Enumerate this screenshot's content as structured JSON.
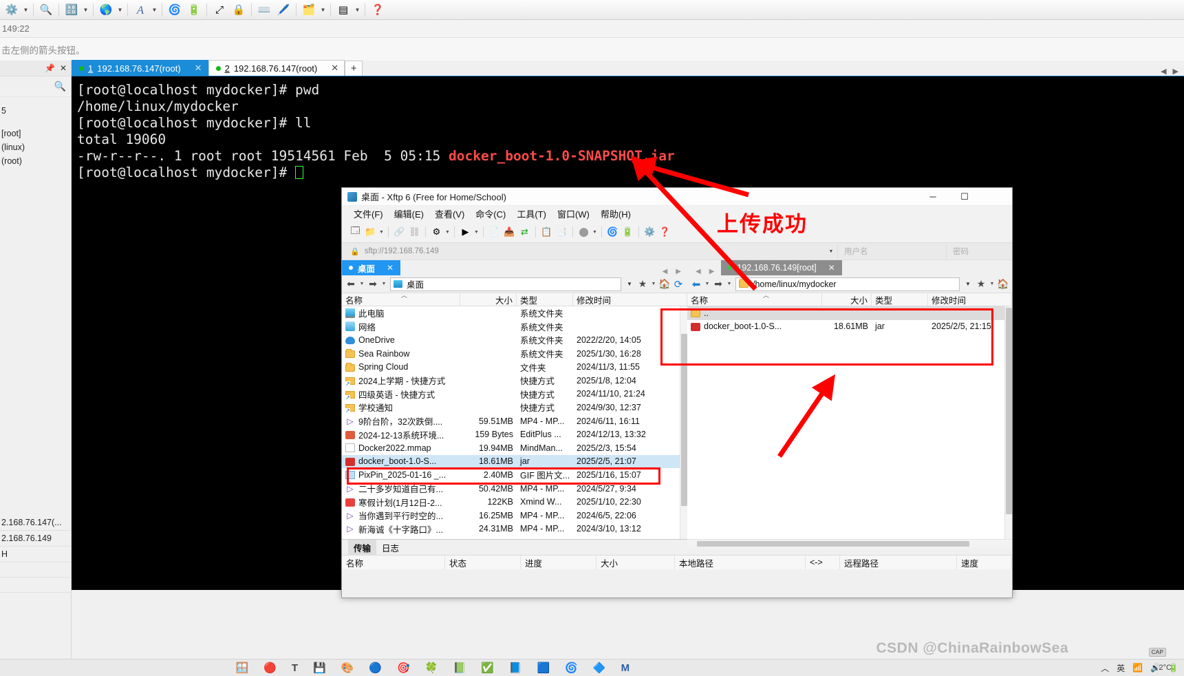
{
  "xshell": {
    "toolbar_icons": [
      "settings-gear-icon",
      "dropdown-caret",
      "search-icon",
      "layout-icon",
      "dropdown-caret",
      "globe-icon",
      "dropdown-caret",
      "font-icon",
      "dropdown-caret",
      "xftp-icon",
      "green-tool-icon",
      "fullscreen-icon",
      "lock-icon",
      "keyboard-icon",
      "pen-icon",
      "new-folder-icon",
      "dropdown-caret",
      "split-view-icon",
      "dropdown-caret",
      "help-icon"
    ],
    "timebar": "149:22",
    "hint": "击左侧的箭头按钮。",
    "dock": {
      "pin_icon": "pin-icon",
      "close_icon": "close-icon",
      "search_icon": "search-icon",
      "items": [
        "5",
        "[root]",
        "(linux)",
        "(root)"
      ],
      "bottom_items": [
        "2.168.76.147(...",
        "2.168.76.149",
        "H",
        "",
        ""
      ]
    },
    "tabs": [
      {
        "num": "1",
        "label": "192.168.76.147(root)",
        "active": true
      },
      {
        "num": "2",
        "label": "192.168.76.147(root)",
        "active": false
      }
    ],
    "new_tab_label": "+",
    "terminal": {
      "line1": "[root@localhost mydocker]# pwd",
      "line2": "/home/linux/mydocker",
      "line3": "[root@localhost mydocker]# ll",
      "line4": "total 19060",
      "line5_prefix": "-rw-r--r--. 1 root root 19514561 Feb  5 05:15 ",
      "line5_file": "docker_boot-1.0-SNAPSHOT.jar",
      "line6": "[root@localhost mydocker]# "
    }
  },
  "xftp": {
    "title": "桌面 - Xftp 6 (Free for Home/School)",
    "window_buttons": [
      "minimize",
      "maximize",
      "close"
    ],
    "menu": [
      "文件(F)",
      "编辑(E)",
      "查看(V)",
      "命令(C)",
      "工具(T)",
      "窗口(W)",
      "帮助(H)"
    ],
    "address": {
      "url": "sftp://192.168.76.149",
      "lock_icon": "lock-icon",
      "username_placeholder": "用户名",
      "password_placeholder": "密码"
    },
    "left": {
      "session_tab": "桌面",
      "path": "桌面",
      "columns": [
        "名称",
        "大小",
        "类型",
        "修改时间"
      ],
      "rows": [
        {
          "icon": "ico-pc",
          "name": "此电脑",
          "size": "",
          "type": "系统文件夹",
          "time": ""
        },
        {
          "icon": "ico-net",
          "name": "网络",
          "size": "",
          "type": "系统文件夹",
          "time": ""
        },
        {
          "icon": "ico-cloud",
          "name": "OneDrive",
          "size": "",
          "type": "系统文件夹",
          "time": "2022/2/20, 14:05"
        },
        {
          "icon": "ico-folder",
          "name": "Sea Rainbow",
          "size": "",
          "type": "系统文件夹",
          "time": "2025/1/30, 16:28"
        },
        {
          "icon": "ico-folder",
          "name": "Spring Cloud",
          "size": "",
          "type": "文件夹",
          "time": "2024/11/3, 11:55"
        },
        {
          "icon": "ico-shortcut",
          "name": "2024上学期 - 快捷方式",
          "size": "",
          "type": "快捷方式",
          "time": "2025/1/8, 12:04"
        },
        {
          "icon": "ico-shortcut",
          "name": "四级英语 - 快捷方式",
          "size": "",
          "type": "快捷方式",
          "time": "2024/11/10, 21:24"
        },
        {
          "icon": "ico-shortcut",
          "name": "学校通知",
          "size": "",
          "type": "快捷方式",
          "time": "2024/9/30, 12:37"
        },
        {
          "icon": "ico-mp4",
          "name": "9阶台阶，32次跌倒....",
          "size": "59.51MB",
          "type": "MP4 - MP...",
          "time": "2024/6/11, 16:11"
        },
        {
          "icon": "ico-edit",
          "name": "2024-12-13系统环境...",
          "size": "159 Bytes",
          "type": "EditPlus ...",
          "time": "2024/12/13, 13:32"
        },
        {
          "icon": "ico-doc",
          "name": "Docker2022.mmap",
          "size": "19.94MB",
          "type": "MindMan...",
          "time": "2025/2/3, 15:54"
        },
        {
          "icon": "ico-jar",
          "name": "docker_boot-1.0-S...",
          "size": "18.61MB",
          "type": "jar",
          "time": "2025/2/5, 21:07",
          "selected": true
        },
        {
          "icon": "ico-gif",
          "name": "PixPin_2025-01-16 _...",
          "size": "2.40MB",
          "type": "GIF 图片文...",
          "time": "2025/1/16, 15:07"
        },
        {
          "icon": "ico-mp4",
          "name": "二十多岁知道自己有...",
          "size": "50.42MB",
          "type": "MP4 - MP...",
          "time": "2024/5/27, 9:34"
        },
        {
          "icon": "ico-xmind",
          "name": "寒假计划(1月12日-2...",
          "size": "122KB",
          "type": "Xmind W...",
          "time": "2025/1/10, 22:30"
        },
        {
          "icon": "ico-mp4",
          "name": "当你遇到平行时空的...",
          "size": "16.25MB",
          "type": "MP4 - MP...",
          "time": "2024/6/5, 22:06"
        },
        {
          "icon": "ico-mp4",
          "name": "新海诚《十字路口》...",
          "size": "24.31MB",
          "type": "MP4 - MP...",
          "time": "2024/3/10, 13:12"
        }
      ]
    },
    "right": {
      "session_tab": "192.168.76.149[root]",
      "path": "/home/linux/mydocker",
      "columns": [
        "名称",
        "大小",
        "类型",
        "修改时间"
      ],
      "rows": [
        {
          "icon": "ico-folder",
          "name": "..",
          "size": "",
          "type": "",
          "time": "",
          "updir": true
        },
        {
          "icon": "ico-jar",
          "name": "docker_boot-1.0-S...",
          "size": "18.61MB",
          "type": "jar",
          "time": "2025/2/5, 21:15"
        }
      ]
    },
    "transfer": {
      "tabs": [
        "传输",
        "日志"
      ],
      "active_tab": "传输",
      "columns": [
        "名称",
        "状态",
        "进度",
        "大小",
        "本地路径",
        "<->",
        "远程路径",
        "速度"
      ]
    }
  },
  "annotations": {
    "success_text": "上传成功",
    "accent_red": "#ff0000",
    "watermark": "CSDN @ChinaRainbowSea"
  },
  "taskbar": {
    "icons": [
      "windows-icon",
      "chrome-icon",
      "text-icon",
      "save-icon",
      "app-icon",
      "app-icon",
      "app-icon",
      "app-icon",
      "app-icon",
      "app-icon",
      "app-icon",
      "app-icon",
      "edge-icon",
      "app-icon"
    ],
    "tray": [
      "chevron-up-icon",
      "ime-英",
      "wifi-icon",
      "speaker-icon",
      "battery-icon"
    ],
    "cap_badge": "CAP",
    "time": "2°C"
  }
}
